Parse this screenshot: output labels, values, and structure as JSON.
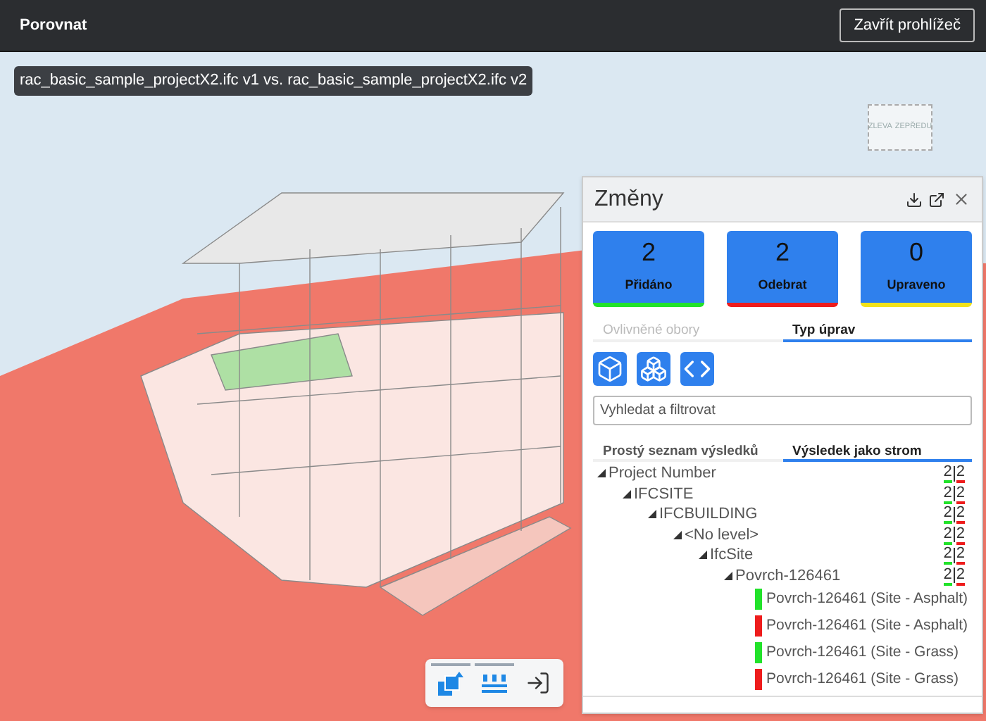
{
  "header": {
    "title": "Porovnat",
    "close_button": "Zavřít prohlížeč"
  },
  "viewport": {
    "comparison_label": "rac_basic_sample_projectX2.ifc v1 vs. rac_basic_sample_projectX2.ifc v2",
    "viewcube": [
      "ZLEVA",
      "ZEPŘEDU"
    ],
    "toolbar": [
      {
        "kind": "layers",
        "selected": true
      },
      {
        "kind": "list",
        "selected": true
      },
      {
        "kind": "exit",
        "selected": false
      }
    ]
  },
  "panel": {
    "title": "Změny",
    "stats": [
      {
        "count": "2",
        "label": "Přidáno",
        "color": "#22e22a"
      },
      {
        "count": "2",
        "label": "Odebrat",
        "color": "#ee1c1c"
      },
      {
        "count": "0",
        "label": "Upraveno",
        "color": "#f2e21a"
      }
    ],
    "scope_tabs": [
      {
        "label": "Ovlivněné obory",
        "selected": false,
        "disabled": true
      },
      {
        "label": "Typ úprav",
        "selected": true,
        "disabled": false
      }
    ],
    "filter_buttons": [
      {
        "kind": "box"
      },
      {
        "kind": "boxes"
      },
      {
        "kind": "code"
      }
    ],
    "search": {
      "placeholder": "Vyhledat a filtrovat"
    },
    "view_tabs": [
      {
        "label": "Prostý seznam výsledků",
        "selected": false
      },
      {
        "label": "Výsledek jako strom",
        "selected": true
      }
    ],
    "tree": [
      {
        "label": "Project Number",
        "added": "2",
        "removed": "2",
        "expanded": true,
        "children": [
          {
            "label": "IFCSITE",
            "added": "2",
            "removed": "2",
            "expanded": true,
            "children": [
              {
                "label": "IFCBUILDING",
                "added": "2",
                "removed": "2",
                "expanded": true,
                "children": [
                  {
                    "label": "<No level>",
                    "added": "2",
                    "removed": "2",
                    "expanded": true,
                    "children": [
                      {
                        "label": "IfcSite",
                        "added": "2",
                        "removed": "2",
                        "expanded": true,
                        "children": [
                          {
                            "label": "Povrch-126461",
                            "added": "2",
                            "removed": "2",
                            "expanded": true,
                            "children": [
                              {
                                "label": "Povrch-126461 (Site - Asphalt)",
                                "color": "#22e22a"
                              },
                              {
                                "label": "Povrch-126461 (Site - Asphalt)",
                                "color": "#ee1c1c"
                              },
                              {
                                "label": "Povrch-126461 (Site - Grass)",
                                "color": "#22e22a"
                              },
                              {
                                "label": "Povrch-126461 (Site - Grass)",
                                "color": "#ee1c1c"
                              }
                            ]
                          }
                        ]
                      }
                    ]
                  }
                ]
              }
            ]
          }
        ]
      }
    ]
  }
}
